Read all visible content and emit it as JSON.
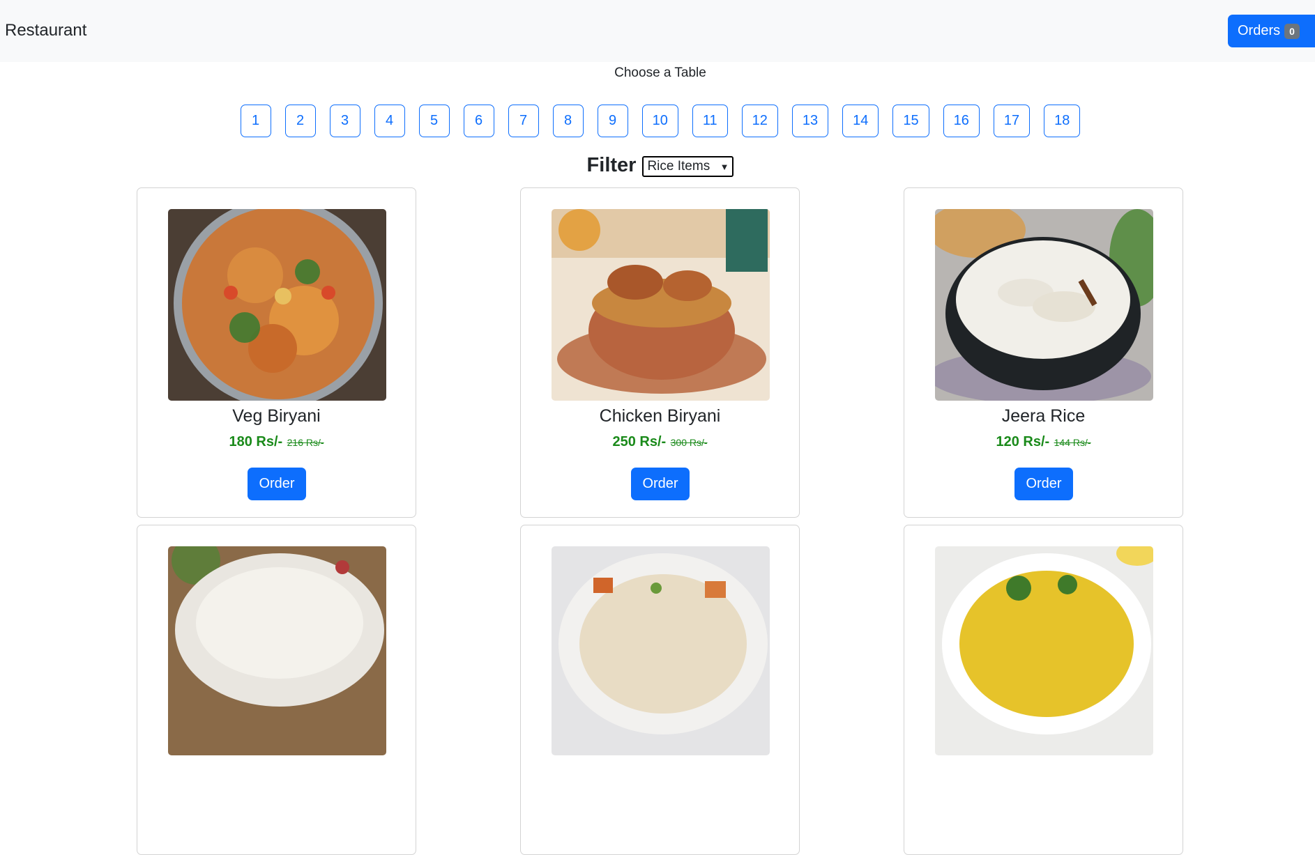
{
  "navbar": {
    "brand": "Restaurant",
    "orders_label": "Orders",
    "orders_count": "0"
  },
  "tables": {
    "heading": "Choose a Table",
    "numbers": [
      "1",
      "2",
      "3",
      "4",
      "5",
      "6",
      "7",
      "8",
      "9",
      "10",
      "11",
      "12",
      "13",
      "14",
      "15",
      "16",
      "17",
      "18"
    ]
  },
  "filter": {
    "label": "Filter",
    "selected": "Rice Items"
  },
  "menu_items": [
    {
      "name": "Veg Biryani",
      "price": "180 Rs/-",
      "old_price": "216 Rs/-",
      "order_label": "Order",
      "image": "veg-biryani-photo"
    },
    {
      "name": "Chicken Biryani",
      "price": "250 Rs/-",
      "old_price": "300 Rs/-",
      "order_label": "Order",
      "image": "chicken-biryani-photo"
    },
    {
      "name": "Jeera Rice",
      "price": "120 Rs/-",
      "old_price": "144 Rs/-",
      "order_label": "Order",
      "image": "jeera-rice-photo"
    }
  ],
  "colors": {
    "primary": "#0d6efd",
    "price_green": "#1a8a1a",
    "navbar_bg": "#f8f9fa"
  }
}
